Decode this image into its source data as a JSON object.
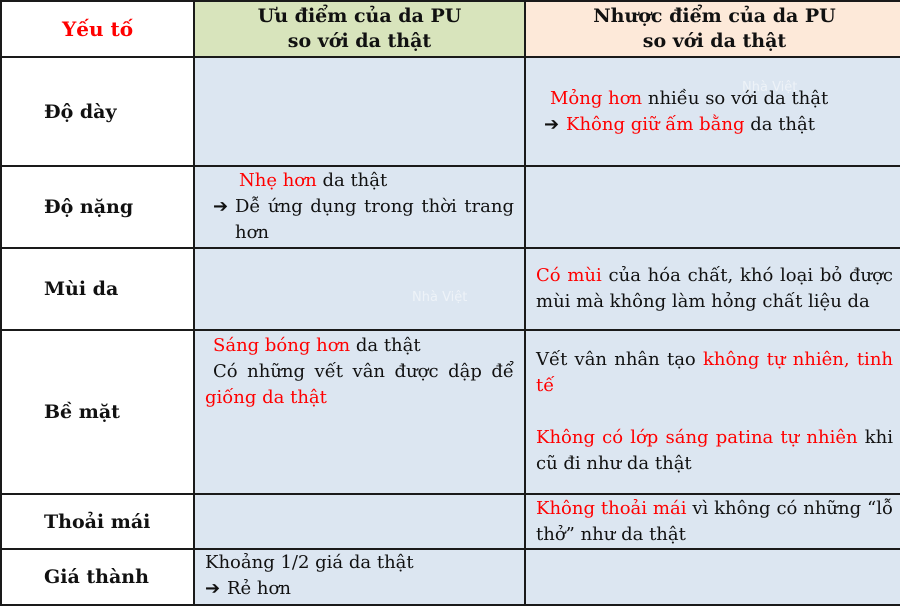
{
  "header": {
    "factor": "Yếu tố",
    "pros_line1": "Ưu điểm của da PU",
    "pros_line2": "so với da thật",
    "cons_line1": "Nhược điểm của da PU",
    "cons_line2": "so với da thật"
  },
  "colors": {
    "header_pros_bg": "#d8e4bc",
    "header_cons_bg": "#fde9d9",
    "cell_bg": "#dce6f1",
    "highlight": "#ff0000"
  },
  "icons": {
    "arrow": "➔"
  },
  "rows": [
    {
      "factor": "Độ dày",
      "pros": {},
      "cons": {
        "l1_red": "Mỏng hơn",
        "l1_rest": " nhiều so với da thật",
        "l2_red": "Không giữ ấm bằng",
        "l2_rest": " da thật"
      }
    },
    {
      "factor": "Độ nặng",
      "pros": {
        "l1_red": "Nhẹ hơn",
        "l1_rest": " da thật",
        "l2_text": "Dễ ứng dụng trong thời trang hơn"
      },
      "cons": {}
    },
    {
      "factor": "Mùi da",
      "pros": {},
      "cons": {
        "l1_red": "Có mùi",
        "l1_rest": " của hóa chất, khó loại bỏ được mùi mà không làm hỏng chất liệu da"
      }
    },
    {
      "factor": "Bề mặt",
      "pros": {
        "l1_red": "Sáng bóng hơn",
        "l1_rest": " da thật",
        "l2_text": "Có những vết vân được dập để ",
        "l2_red": "giống da thật"
      },
      "cons": {
        "l1_text": "Vết vân nhân tạo ",
        "l1_red": "không tự nhiên, tinh tế",
        "l2_red": "Không có lớp sáng patina tự nhiên",
        "l2_rest": " khi cũ đi như da thật"
      }
    },
    {
      "factor": "Thoải mái",
      "pros": {},
      "cons": {
        "l1_red": "Không thoải mái",
        "l1_rest": " vì không có những “lỗ thở” như da thật"
      }
    },
    {
      "factor": "Giá thành",
      "pros": {
        "l1_text": "Khoảng 1/2 giá da thật",
        "l2_text": "Rẻ hơn"
      },
      "cons": {}
    }
  ],
  "watermark": "Nhà Việt"
}
